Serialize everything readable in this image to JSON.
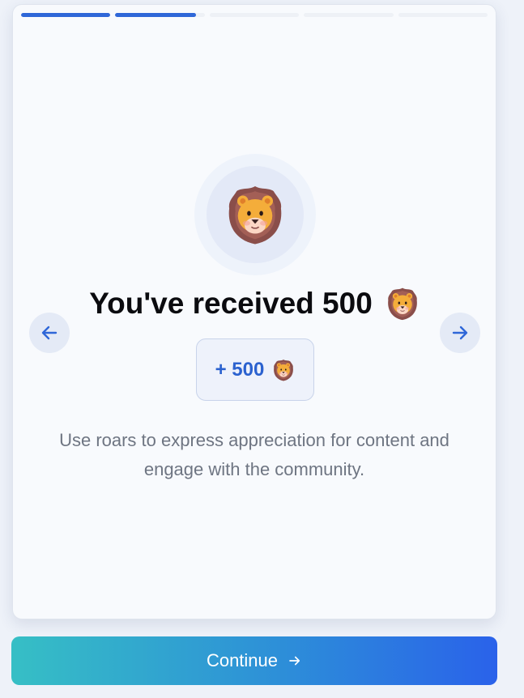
{
  "progress": {
    "total_steps": 5,
    "current_step": 2,
    "segments": [
      1,
      0.9,
      0,
      0,
      0
    ]
  },
  "slide": {
    "title": "You've received 500",
    "reward_label": "+ 500",
    "description": "Use roars to express appreciation for content and engage with the community.",
    "icon": "lion-icon"
  },
  "nav": {
    "prev_icon": "arrow-left-icon",
    "next_icon": "arrow-right-icon"
  },
  "footer": {
    "continue_label": "Continue",
    "continue_icon": "arrow-right-icon"
  },
  "colors": {
    "accent": "#2f67d8",
    "gradient_start": "#36bfc5",
    "gradient_end": "#2a62ea",
    "lion_mane": "#8a4e4a",
    "lion_face": "#f4ad3a"
  }
}
